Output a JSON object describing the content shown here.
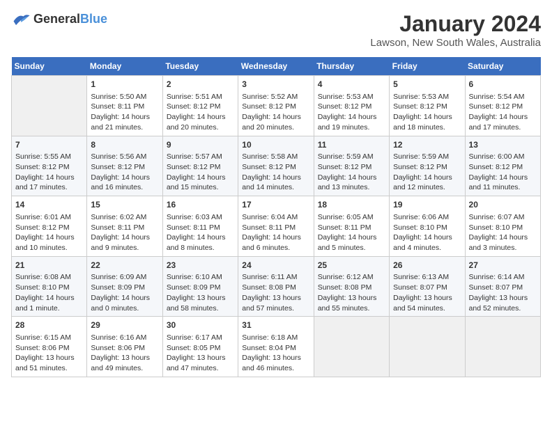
{
  "header": {
    "logo_general": "General",
    "logo_blue": "Blue",
    "month_year": "January 2024",
    "location": "Lawson, New South Wales, Australia"
  },
  "days_of_week": [
    "Sunday",
    "Monday",
    "Tuesday",
    "Wednesday",
    "Thursday",
    "Friday",
    "Saturday"
  ],
  "weeks": [
    [
      {
        "day": "",
        "empty": true
      },
      {
        "day": "1",
        "sunrise": "Sunrise: 5:50 AM",
        "sunset": "Sunset: 8:11 PM",
        "daylight": "Daylight: 14 hours and 21 minutes."
      },
      {
        "day": "2",
        "sunrise": "Sunrise: 5:51 AM",
        "sunset": "Sunset: 8:12 PM",
        "daylight": "Daylight: 14 hours and 20 minutes."
      },
      {
        "day": "3",
        "sunrise": "Sunrise: 5:52 AM",
        "sunset": "Sunset: 8:12 PM",
        "daylight": "Daylight: 14 hours and 20 minutes."
      },
      {
        "day": "4",
        "sunrise": "Sunrise: 5:53 AM",
        "sunset": "Sunset: 8:12 PM",
        "daylight": "Daylight: 14 hours and 19 minutes."
      },
      {
        "day": "5",
        "sunrise": "Sunrise: 5:53 AM",
        "sunset": "Sunset: 8:12 PM",
        "daylight": "Daylight: 14 hours and 18 minutes."
      },
      {
        "day": "6",
        "sunrise": "Sunrise: 5:54 AM",
        "sunset": "Sunset: 8:12 PM",
        "daylight": "Daylight: 14 hours and 17 minutes."
      }
    ],
    [
      {
        "day": "7",
        "sunrise": "Sunrise: 5:55 AM",
        "sunset": "Sunset: 8:12 PM",
        "daylight": "Daylight: 14 hours and 17 minutes."
      },
      {
        "day": "8",
        "sunrise": "Sunrise: 5:56 AM",
        "sunset": "Sunset: 8:12 PM",
        "daylight": "Daylight: 14 hours and 16 minutes."
      },
      {
        "day": "9",
        "sunrise": "Sunrise: 5:57 AM",
        "sunset": "Sunset: 8:12 PM",
        "daylight": "Daylight: 14 hours and 15 minutes."
      },
      {
        "day": "10",
        "sunrise": "Sunrise: 5:58 AM",
        "sunset": "Sunset: 8:12 PM",
        "daylight": "Daylight: 14 hours and 14 minutes."
      },
      {
        "day": "11",
        "sunrise": "Sunrise: 5:59 AM",
        "sunset": "Sunset: 8:12 PM",
        "daylight": "Daylight: 14 hours and 13 minutes."
      },
      {
        "day": "12",
        "sunrise": "Sunrise: 5:59 AM",
        "sunset": "Sunset: 8:12 PM",
        "daylight": "Daylight: 14 hours and 12 minutes."
      },
      {
        "day": "13",
        "sunrise": "Sunrise: 6:00 AM",
        "sunset": "Sunset: 8:12 PM",
        "daylight": "Daylight: 14 hours and 11 minutes."
      }
    ],
    [
      {
        "day": "14",
        "sunrise": "Sunrise: 6:01 AM",
        "sunset": "Sunset: 8:12 PM",
        "daylight": "Daylight: 14 hours and 10 minutes."
      },
      {
        "day": "15",
        "sunrise": "Sunrise: 6:02 AM",
        "sunset": "Sunset: 8:11 PM",
        "daylight": "Daylight: 14 hours and 9 minutes."
      },
      {
        "day": "16",
        "sunrise": "Sunrise: 6:03 AM",
        "sunset": "Sunset: 8:11 PM",
        "daylight": "Daylight: 14 hours and 8 minutes."
      },
      {
        "day": "17",
        "sunrise": "Sunrise: 6:04 AM",
        "sunset": "Sunset: 8:11 PM",
        "daylight": "Daylight: 14 hours and 6 minutes."
      },
      {
        "day": "18",
        "sunrise": "Sunrise: 6:05 AM",
        "sunset": "Sunset: 8:11 PM",
        "daylight": "Daylight: 14 hours and 5 minutes."
      },
      {
        "day": "19",
        "sunrise": "Sunrise: 6:06 AM",
        "sunset": "Sunset: 8:10 PM",
        "daylight": "Daylight: 14 hours and 4 minutes."
      },
      {
        "day": "20",
        "sunrise": "Sunrise: 6:07 AM",
        "sunset": "Sunset: 8:10 PM",
        "daylight": "Daylight: 14 hours and 3 minutes."
      }
    ],
    [
      {
        "day": "21",
        "sunrise": "Sunrise: 6:08 AM",
        "sunset": "Sunset: 8:10 PM",
        "daylight": "Daylight: 14 hours and 1 minute."
      },
      {
        "day": "22",
        "sunrise": "Sunrise: 6:09 AM",
        "sunset": "Sunset: 8:09 PM",
        "daylight": "Daylight: 14 hours and 0 minutes."
      },
      {
        "day": "23",
        "sunrise": "Sunrise: 6:10 AM",
        "sunset": "Sunset: 8:09 PM",
        "daylight": "Daylight: 13 hours and 58 minutes."
      },
      {
        "day": "24",
        "sunrise": "Sunrise: 6:11 AM",
        "sunset": "Sunset: 8:08 PM",
        "daylight": "Daylight: 13 hours and 57 minutes."
      },
      {
        "day": "25",
        "sunrise": "Sunrise: 6:12 AM",
        "sunset": "Sunset: 8:08 PM",
        "daylight": "Daylight: 13 hours and 55 minutes."
      },
      {
        "day": "26",
        "sunrise": "Sunrise: 6:13 AM",
        "sunset": "Sunset: 8:07 PM",
        "daylight": "Daylight: 13 hours and 54 minutes."
      },
      {
        "day": "27",
        "sunrise": "Sunrise: 6:14 AM",
        "sunset": "Sunset: 8:07 PM",
        "daylight": "Daylight: 13 hours and 52 minutes."
      }
    ],
    [
      {
        "day": "28",
        "sunrise": "Sunrise: 6:15 AM",
        "sunset": "Sunset: 8:06 PM",
        "daylight": "Daylight: 13 hours and 51 minutes."
      },
      {
        "day": "29",
        "sunrise": "Sunrise: 6:16 AM",
        "sunset": "Sunset: 8:06 PM",
        "daylight": "Daylight: 13 hours and 49 minutes."
      },
      {
        "day": "30",
        "sunrise": "Sunrise: 6:17 AM",
        "sunset": "Sunset: 8:05 PM",
        "daylight": "Daylight: 13 hours and 47 minutes."
      },
      {
        "day": "31",
        "sunrise": "Sunrise: 6:18 AM",
        "sunset": "Sunset: 8:04 PM",
        "daylight": "Daylight: 13 hours and 46 minutes."
      },
      {
        "day": "",
        "empty": true
      },
      {
        "day": "",
        "empty": true
      },
      {
        "day": "",
        "empty": true
      }
    ]
  ]
}
